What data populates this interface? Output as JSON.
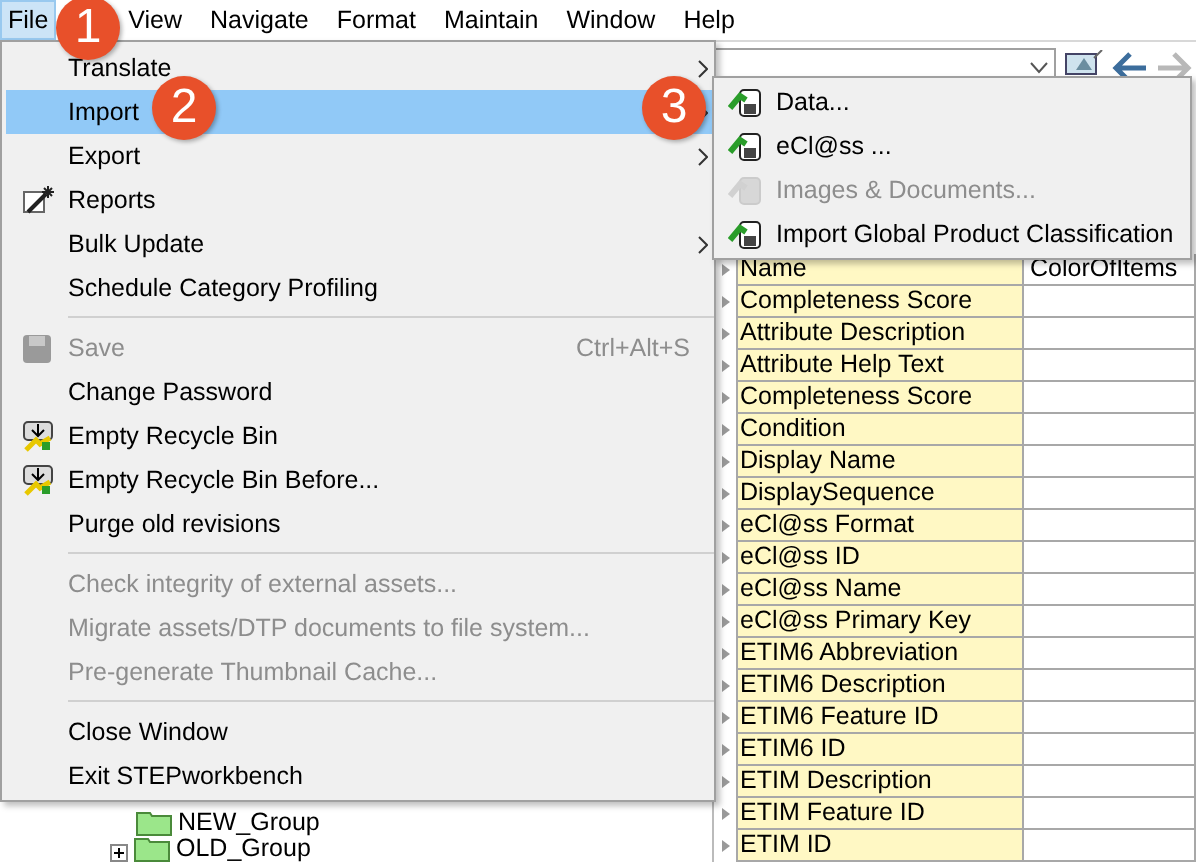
{
  "menubar": [
    {
      "label": "File",
      "selected": true
    },
    {
      "label": "View",
      "selected": false
    },
    {
      "label": "Navigate",
      "selected": false
    },
    {
      "label": "Format",
      "selected": false
    },
    {
      "label": "Maintain",
      "selected": false
    },
    {
      "label": "Window",
      "selected": false
    },
    {
      "label": "Help",
      "selected": false
    }
  ],
  "file_menu": {
    "sections": [
      [
        {
          "label": "Translate",
          "submenu": true,
          "selected": false,
          "disabled": false
        },
        {
          "label": "Import",
          "submenu": true,
          "selected": true,
          "disabled": false
        },
        {
          "label": "Export",
          "submenu": true,
          "selected": false,
          "disabled": false
        },
        {
          "label": "Reports",
          "kind": "wand",
          "submenu": false,
          "selected": false,
          "disabled": false
        },
        {
          "label": "Bulk Update",
          "submenu": true,
          "selected": false,
          "disabled": false
        },
        {
          "label": "Schedule Category Profiling",
          "submenu": false,
          "selected": false,
          "disabled": false
        }
      ],
      [
        {
          "label": "Save",
          "kind": "floppy",
          "shortcut": "Ctrl+Alt+S",
          "submenu": false,
          "selected": false,
          "disabled": true
        },
        {
          "label": "Change Password",
          "submenu": false,
          "selected": false,
          "disabled": false
        },
        {
          "label": "Empty Recycle Bin",
          "kind": "bin",
          "submenu": false,
          "selected": false,
          "disabled": false
        },
        {
          "label": "Empty Recycle Bin Before...",
          "kind": "bin",
          "submenu": false,
          "selected": false,
          "disabled": false
        },
        {
          "label": "Purge old revisions",
          "submenu": false,
          "selected": false,
          "disabled": false
        }
      ],
      [
        {
          "label": "Check integrity of external assets...",
          "submenu": false,
          "selected": false,
          "disabled": true
        },
        {
          "label": "Migrate assets/DTP documents to file system...",
          "submenu": false,
          "selected": false,
          "disabled": true
        },
        {
          "label": "Pre-generate Thumbnail Cache...",
          "submenu": false,
          "selected": false,
          "disabled": true
        }
      ],
      [
        {
          "label": "Close Window",
          "submenu": false,
          "selected": false,
          "disabled": false
        },
        {
          "label": "Exit STEPworkbench",
          "submenu": false,
          "selected": false,
          "disabled": false
        }
      ]
    ]
  },
  "import_submenu": [
    {
      "label": "Data...",
      "disabled": false
    },
    {
      "label": "eCl@ss ...",
      "disabled": false
    },
    {
      "label": "Images & Documents...",
      "disabled": true
    },
    {
      "label": "Import Global Product Classification",
      "disabled": false
    }
  ],
  "callouts": [
    "1",
    "2",
    "3"
  ],
  "tree": [
    {
      "label": "NEW_Group",
      "expandable": false
    },
    {
      "label": "OLD_Group",
      "expandable": true
    }
  ],
  "table": {
    "rows": [
      [
        "Name",
        "ColorOfItems"
      ],
      [
        "Completeness Score",
        ""
      ],
      [
        "Attribute Description",
        ""
      ],
      [
        "Attribute Help Text",
        ""
      ],
      [
        "Completeness Score",
        ""
      ],
      [
        "Condition",
        ""
      ],
      [
        "Display Name",
        ""
      ],
      [
        "DisplaySequence",
        ""
      ],
      [
        "eCl@ss Format",
        ""
      ],
      [
        "eCl@ss ID",
        ""
      ],
      [
        "eCl@ss Name",
        ""
      ],
      [
        "eCl@ss Primary Key",
        ""
      ],
      [
        "ETIM6 Abbreviation",
        ""
      ],
      [
        "ETIM6 Description",
        ""
      ],
      [
        "ETIM6 Feature ID",
        ""
      ],
      [
        "ETIM6 ID",
        ""
      ],
      [
        "ETIM Description",
        ""
      ],
      [
        "ETIM Feature ID",
        ""
      ],
      [
        "ETIM ID",
        ""
      ]
    ]
  }
}
